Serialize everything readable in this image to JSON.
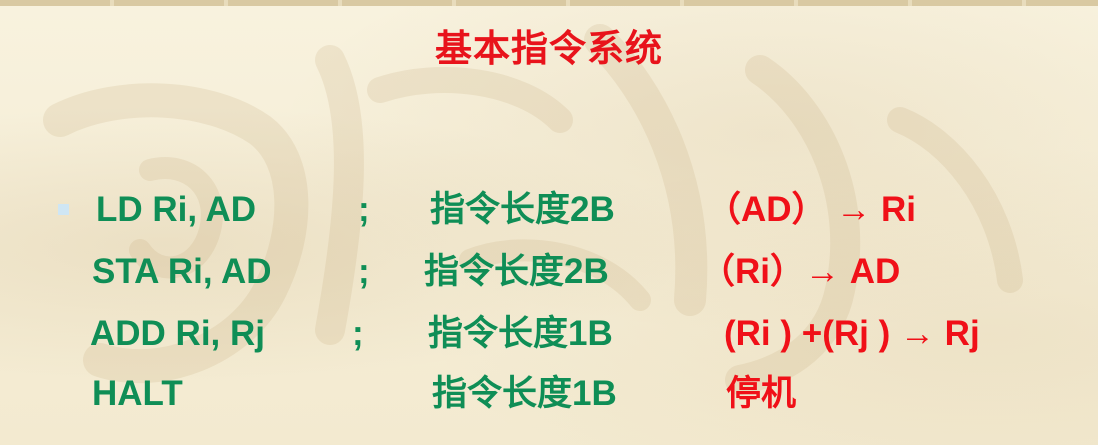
{
  "title": "基本指令系统",
  "instructions": [
    {
      "op": "LD  Ri,   AD",
      "sep": ";",
      "length": "指令长度2B",
      "action": "（AD） → Ri"
    },
    {
      "op": "STA Ri,  AD",
      "sep": ";",
      "length": "指令长度2B",
      "action": "（Ri）→ AD"
    },
    {
      "op": "ADD Ri,  Rj",
      "sep": ";",
      "length": "指令长度1B",
      "action": "(Ri ) +(Rj ) → Rj"
    },
    {
      "op": "HALT",
      "sep": "",
      "length": "指令长度1B",
      "action": "停机"
    }
  ],
  "colors": {
    "title": "#e8131b",
    "operand": "#0f8e56",
    "action": "#f01018",
    "bullet": "#cfe6f4",
    "background": "#f6efd9"
  }
}
